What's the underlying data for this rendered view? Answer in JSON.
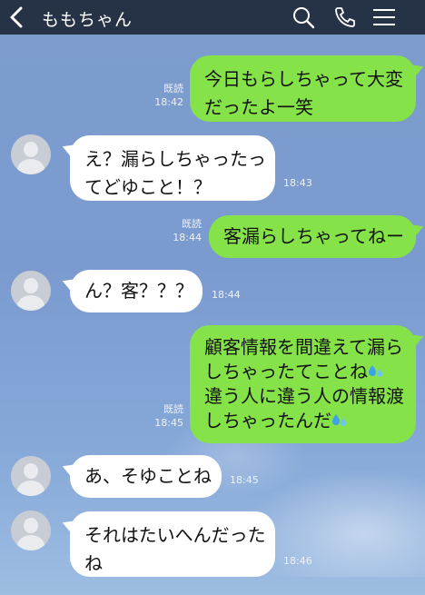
{
  "header": {
    "contact_name": "ももちゃん",
    "icons": [
      "chevron-left-icon",
      "search-icon",
      "phone-icon",
      "menu-icon"
    ],
    "background": "#263245"
  },
  "colors": {
    "sent_bubble": "#85e249",
    "received_bubble": "#ffffff",
    "chat_background": "#7e9ccd"
  },
  "messages": [
    {
      "side": "sent",
      "line1": "今日もらしちゃって大変",
      "line2": "だったよ一笑",
      "read": "既読",
      "time": "18:42"
    },
    {
      "side": "received",
      "line1": "え？漏らしちゃったっ",
      "line2": "てどゆこと！？",
      "time": "18:43"
    },
    {
      "side": "sent",
      "line1": "客漏らしちゃってねー",
      "read": "既読",
      "time": "18:44"
    },
    {
      "side": "received",
      "line1": "ん？客？？？",
      "time": "18:44"
    },
    {
      "side": "sent",
      "line1": "顧客情報を間違えて漏ら",
      "line2": "しちゃったてことね",
      "line3": "違う人に違う人の情報渡",
      "line4": "しちゃったんだ",
      "read": "既読",
      "time": "18:45"
    },
    {
      "side": "received",
      "line1": "あ、そゆことね",
      "time": "18:45"
    },
    {
      "side": "received",
      "line1": "それはたいへんだった",
      "line2": "ね",
      "time": "18:46"
    }
  ]
}
